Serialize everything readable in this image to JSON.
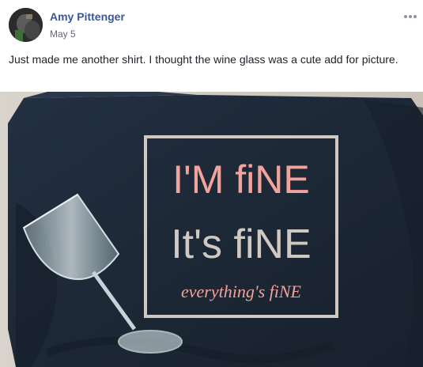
{
  "post": {
    "author": "Amy Pittenger",
    "date": "May 5",
    "text": "Just made me another shirt. I thought the wine glass was a cute add for picture.",
    "more_icon": "more-options-icon",
    "photo": {
      "shirt_text": {
        "line1": "I'M fiNE",
        "line2": "It's fiNE",
        "line3": "everything's fiNE"
      },
      "colors": {
        "shirt": "#1f2b3a",
        "pink": "#f2a39b",
        "silver": "#cfc9c2"
      }
    }
  }
}
